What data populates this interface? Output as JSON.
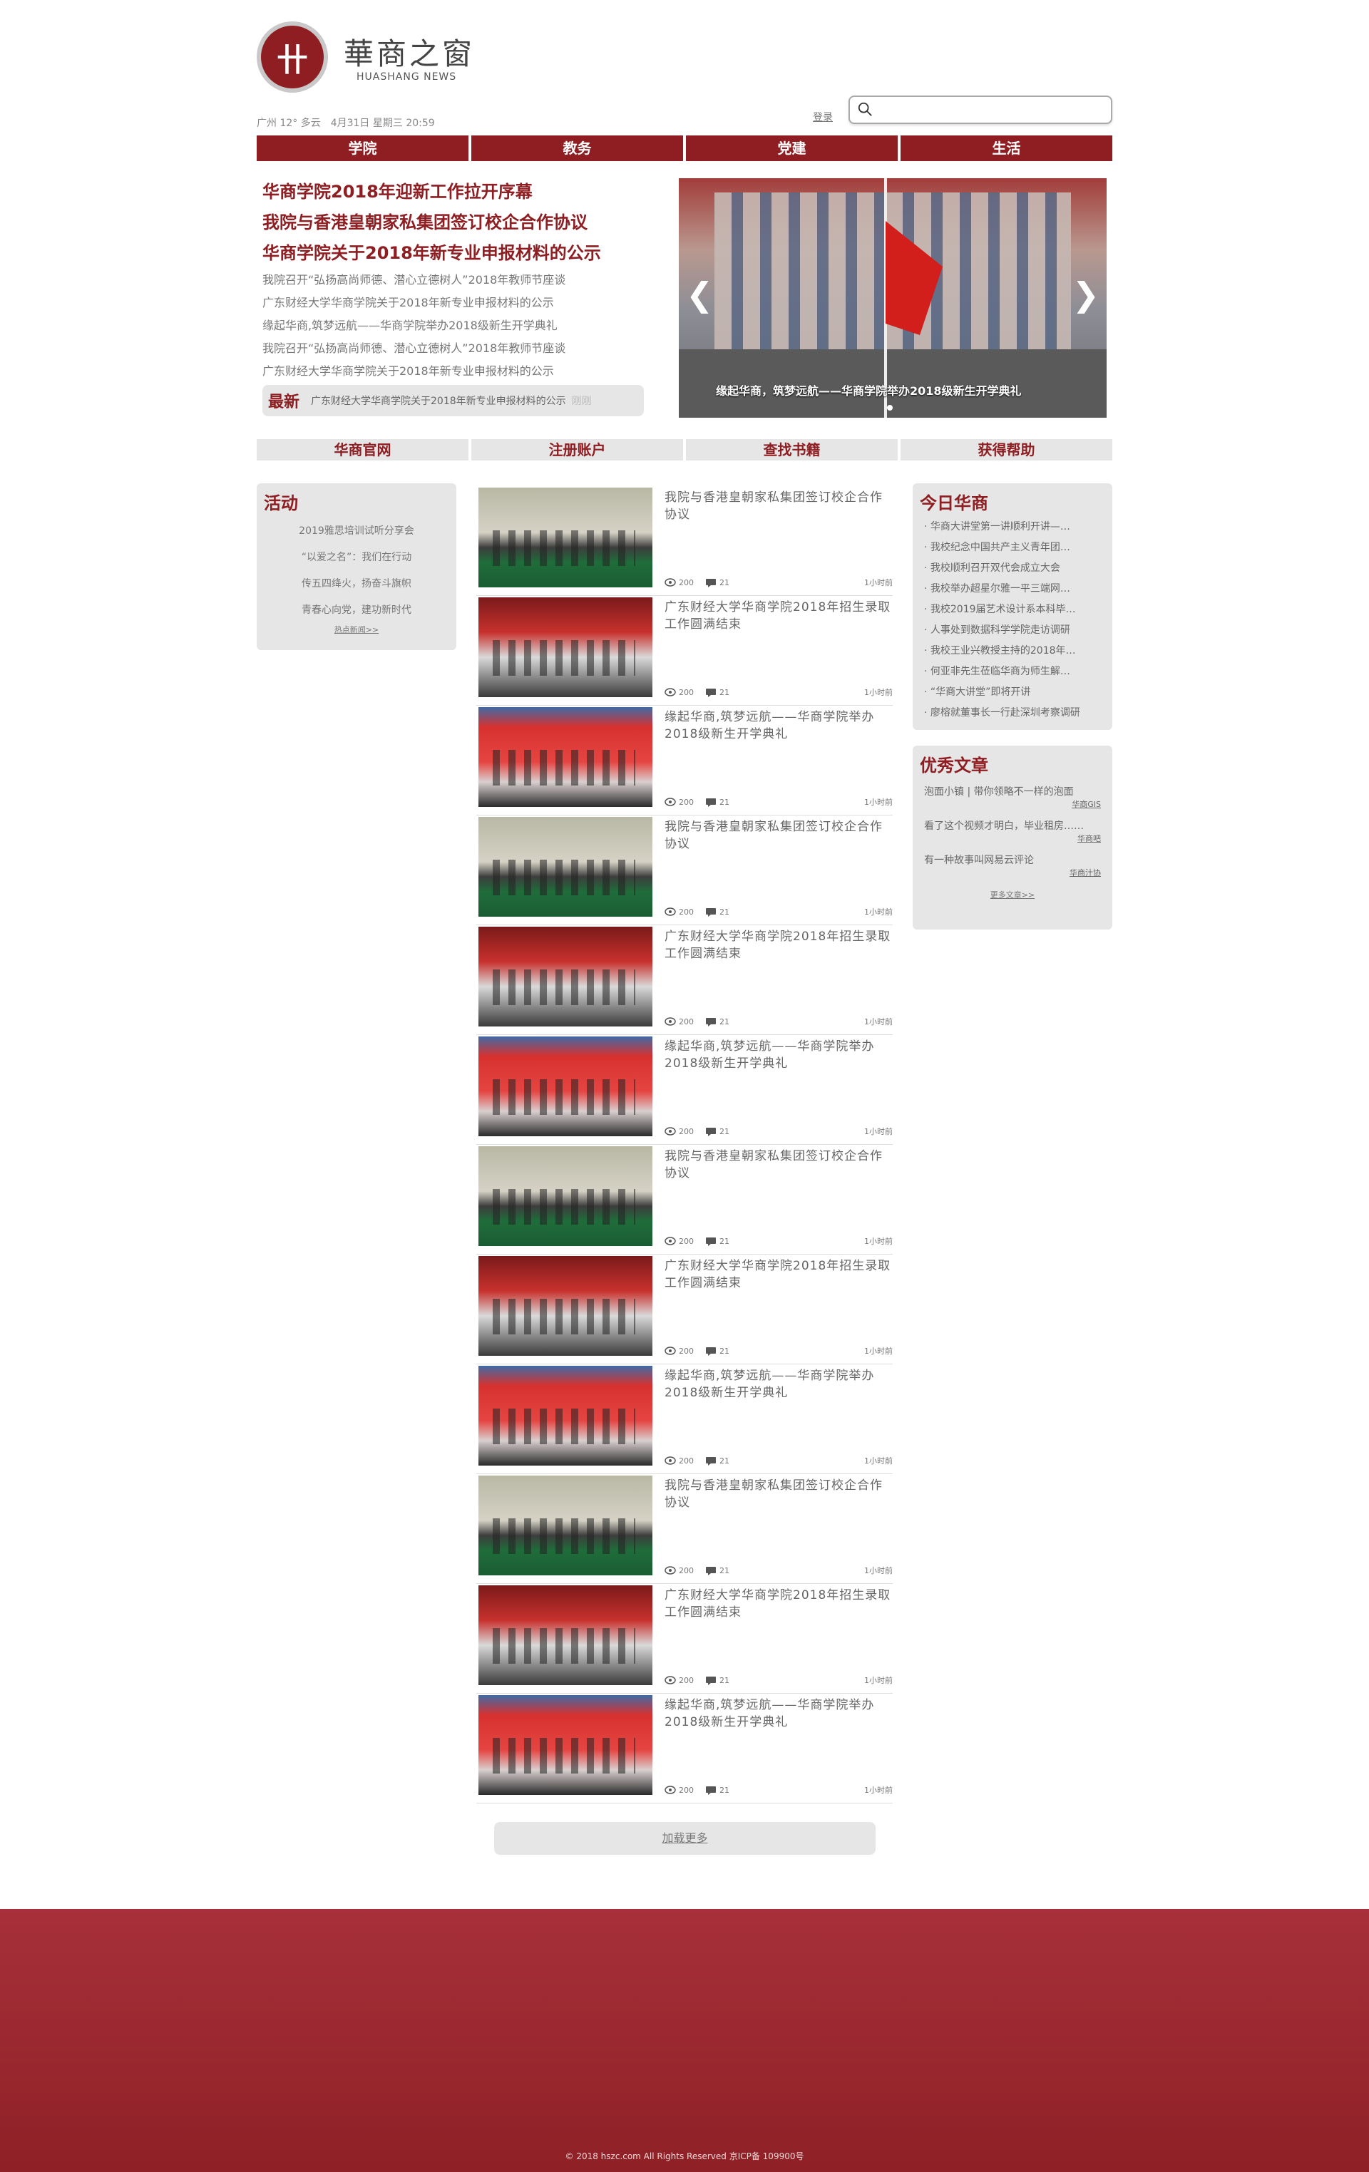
{
  "header": {
    "logo_glyph": "卄",
    "logo_cn": "華商之窗",
    "logo_en": "HUASHANG NEWS",
    "weather_date": "广州 12° 多云　4月31日 星期三 20:59",
    "login": "登录",
    "search_placeholder": ""
  },
  "main_nav": [
    "学院",
    "教务",
    "党建",
    "生活"
  ],
  "headlines": {
    "main": [
      "华商学院2018年迎新工作拉开序幕",
      "我院与香港皇朝家私集团签订校企合作协议",
      "华商学院关于2018年新专业申报材料的公示"
    ],
    "sub": [
      "我院召开“弘扬高尚师德、潜心立德树人”2018年教师节座谈",
      "广东财经大学华商学院关于2018年新专业申报材料的公示",
      "缘起华商,筑梦远航——华商学院举办2018级新生开学典礼",
      "我院召开“弘扬高尚师德、潜心立德树人”2018年教师节座谈",
      "广东财经大学华商学院关于2018年新专业申报材料的公示"
    ],
    "latest_label": "最新",
    "latest_text": "广东财经大学华商学院关于2018年新专业申报材料的公示",
    "latest_muted": "刚刚"
  },
  "carousel": {
    "caption": "缘起华商，筑梦远航——华商学院举办2018级新生开学典礼",
    "prev": "❮",
    "next": "❯"
  },
  "sub_nav": [
    "华商官网",
    "注册账户",
    "查找书籍",
    "获得帮助"
  ],
  "activity": {
    "title": "活动",
    "items": [
      "2019雅思培训试听分享会",
      "“以爱之名”：我们在行动",
      "传五四绛火，扬奋斗旗帜",
      "青春心向党，建功新时代"
    ],
    "more": "热点新闻>>"
  },
  "today": {
    "title": "今日华商",
    "items": [
      "· 华商大讲堂第一讲顺利开讲—…",
      "· 我校纪念中国共产主义青年团…",
      "· 我校顺利召开双代会成立大会",
      "· 我校举办超星尔雅一平三端网…",
      "· 我校2019届艺术设计系本科毕…",
      "· 人事处到数据科学学院走访调研",
      "· 我校王业兴教授主持的2018年…",
      "· 何亚非先生莅临华商为师生解…",
      "· “华商大讲堂”即将开讲",
      "· 廖榕就董事长一行赴深圳考察调研"
    ]
  },
  "articles": {
    "title": "优秀文章",
    "items": [
      {
        "text": "泡面小镇 | 带你领略不一样的泡面",
        "source": "华商GIS"
      },
      {
        "text": "看了这个视频才明白，毕业租房……",
        "source": "华商吧"
      },
      {
        "text": "有一种故事叫网易云评论",
        "source": "华商汁协"
      }
    ],
    "more": "更多文章>>"
  },
  "feed": [
    {
      "title": "我院与香港皇朝家私集团签订校企合作协议",
      "views": "200",
      "comments": "21",
      "time": "1小时前",
      "img": "a"
    },
    {
      "title": "广东财经大学华商学院2018年招生录取工作圆满结束",
      "views": "200",
      "comments": "21",
      "time": "1小时前",
      "img": "b"
    },
    {
      "title": "缘起华商,筑梦远航——华商学院举办2018级新生开学典礼",
      "views": "200",
      "comments": "21",
      "time": "1小时前",
      "img": "c"
    },
    {
      "title": "我院与香港皇朝家私集团签订校企合作协议",
      "views": "200",
      "comments": "21",
      "time": "1小时前",
      "img": "a"
    },
    {
      "title": "广东财经大学华商学院2018年招生录取工作圆满结束",
      "views": "200",
      "comments": "21",
      "time": "1小时前",
      "img": "b"
    },
    {
      "title": "缘起华商,筑梦远航——华商学院举办2018级新生开学典礼",
      "views": "200",
      "comments": "21",
      "time": "1小时前",
      "img": "c"
    },
    {
      "title": "我院与香港皇朝家私集团签订校企合作协议",
      "views": "200",
      "comments": "21",
      "time": "1小时前",
      "img": "a"
    },
    {
      "title": "广东财经大学华商学院2018年招生录取工作圆满结束",
      "views": "200",
      "comments": "21",
      "time": "1小时前",
      "img": "b"
    },
    {
      "title": "缘起华商,筑梦远航——华商学院举办2018级新生开学典礼",
      "views": "200",
      "comments": "21",
      "time": "1小时前",
      "img": "c"
    },
    {
      "title": "我院与香港皇朝家私集团签订校企合作协议",
      "views": "200",
      "comments": "21",
      "time": "1小时前",
      "img": "a"
    },
    {
      "title": "广东财经大学华商学院2018年招生录取工作圆满结束",
      "views": "200",
      "comments": "21",
      "time": "1小时前",
      "img": "b"
    },
    {
      "title": "缘起华商,筑梦远航——华商学院举办2018级新生开学典礼",
      "views": "200",
      "comments": "21",
      "time": "1小时前",
      "img": "c"
    }
  ],
  "load_more": "加载更多",
  "footer": {
    "copyright": "© 2018 hszc.com All Rights Reserved 京ICP备 109900号"
  },
  "colors": {
    "brand": "#8e1e22",
    "panel": "#e6e6e6",
    "footer": "#a7303a"
  }
}
